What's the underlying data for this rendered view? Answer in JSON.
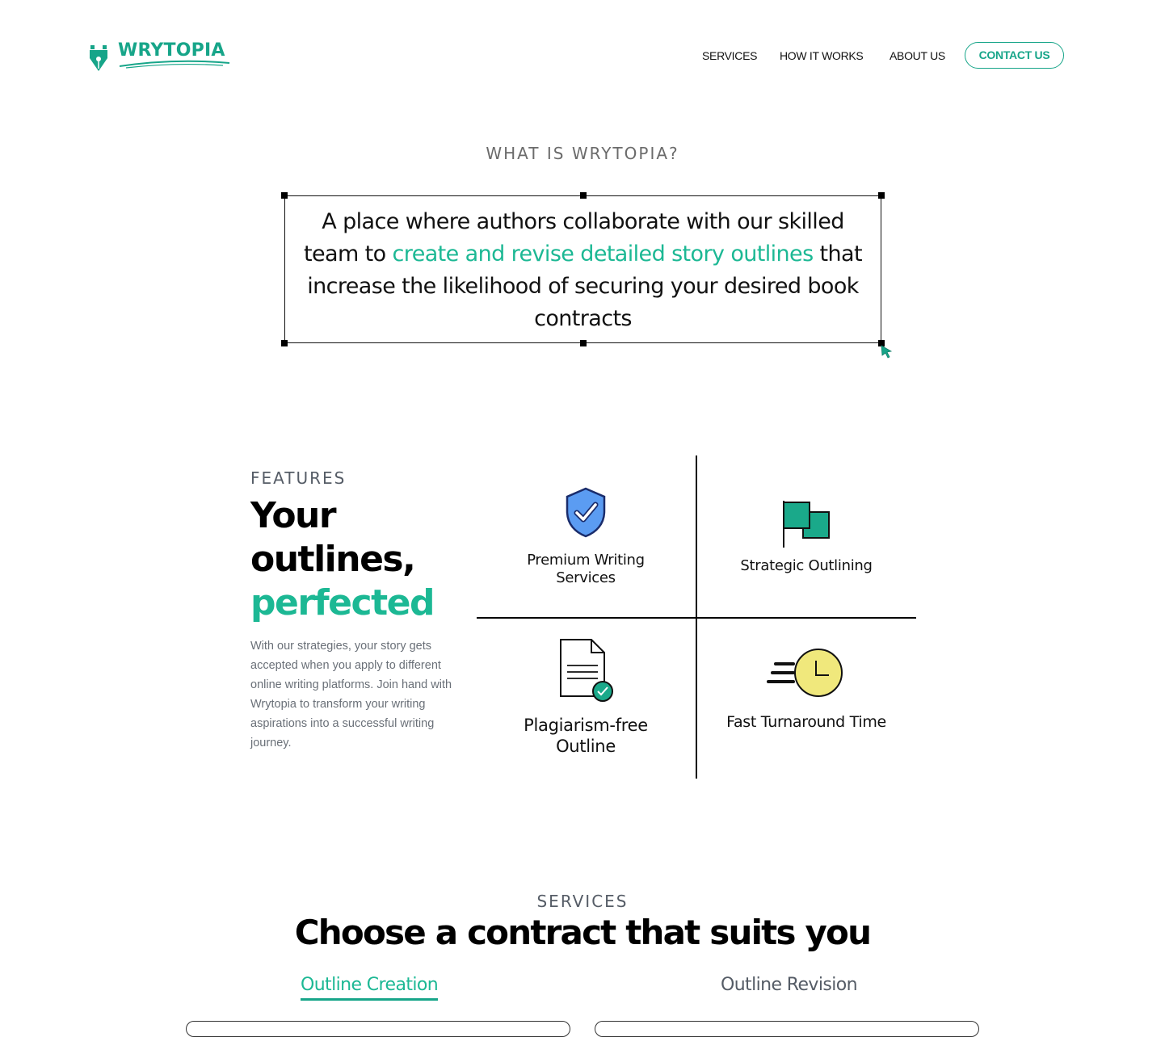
{
  "brand": {
    "name": "WRYTOPIA",
    "accent": "#17a589",
    "accent_text": "#1cb894"
  },
  "nav": {
    "items": [
      {
        "label": "SERVICES"
      },
      {
        "label": "HOW IT WORKS"
      },
      {
        "label": "ABOUT US"
      }
    ],
    "contact_label": "CONTACT US"
  },
  "about": {
    "heading": "WHAT IS WRYTOPIA?",
    "text_before": "A place where authors collaborate with our skilled team to ",
    "text_highlight": "create and revise detailed story outlines",
    "text_after": " that increase the likelihood of securing your desired book contracts"
  },
  "features": {
    "label": "FEATURES",
    "title_line1": "Your",
    "title_line2": "outlines,",
    "title_highlight": "perfected",
    "description": "With our strategies, your story gets accepted when you apply to different online writing platforms. Join hand with Wrytopia to transform your writing aspirations into a successful writing journey.",
    "items": [
      {
        "label": "Premium Writing Services",
        "icon": "shield-check-icon"
      },
      {
        "label": "Strategic Outlining",
        "icon": "flags-icon"
      },
      {
        "label": "Plagiarism-free Outline",
        "icon": "document-check-icon"
      },
      {
        "label": "Fast Turnaround Time",
        "icon": "fast-clock-icon"
      }
    ]
  },
  "services": {
    "label": "SERVICES",
    "title": "Choose a contract that suits you",
    "tabs": [
      {
        "label": "Outline Creation",
        "active": true
      },
      {
        "label": "Outline Revision",
        "active": false
      }
    ]
  }
}
